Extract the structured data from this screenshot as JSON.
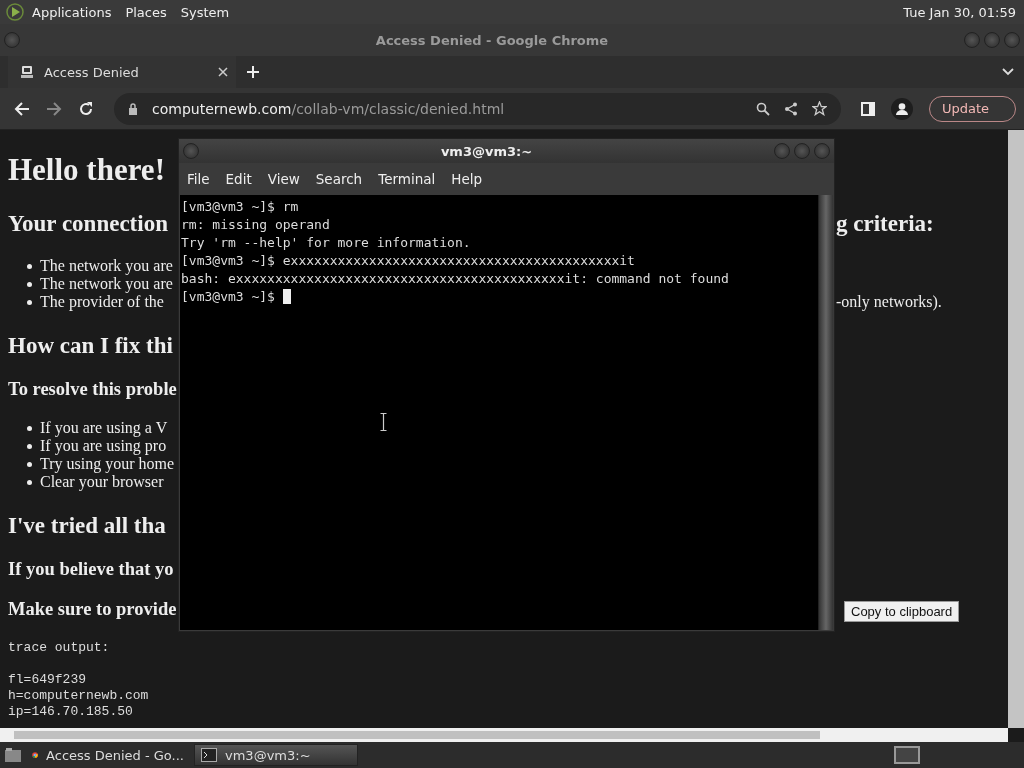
{
  "top_panel": {
    "menus": [
      "Applications",
      "Places",
      "System"
    ],
    "clock": "Tue Jan 30, 01:59"
  },
  "browser": {
    "title": "Access Denied - Google Chrome",
    "tabs": [
      {
        "label": "Access Denied",
        "selected": true
      }
    ],
    "url_domain": "computernewb.com",
    "url_path": "/collab-vm/classic/denied.html",
    "update_label": "Update"
  },
  "page": {
    "left": [
      {
        "kind": "h1",
        "text": "Hello there!"
      },
      {
        "kind": "h2",
        "text": "Your connection"
      },
      {
        "kind": "li",
        "text": "The network you are"
      },
      {
        "kind": "li",
        "text": "The network you are"
      },
      {
        "kind": "li",
        "text": "The provider of the"
      },
      {
        "kind": "h2",
        "text": "How can I fix thi"
      },
      {
        "kind": "h3",
        "text": "To resolve this proble"
      },
      {
        "kind": "li",
        "text": "If you are using a V"
      },
      {
        "kind": "li",
        "text": "If you are using pro"
      },
      {
        "kind": "li",
        "text": "Try using your home"
      },
      {
        "kind": "li",
        "text": "Clear your browser"
      },
      {
        "kind": "h2",
        "text": "I've tried all tha"
      },
      {
        "kind": "h3",
        "text": "If you believe that yo"
      },
      {
        "kind": "h3",
        "text": "Make sure to provide"
      }
    ],
    "trace": {
      "heading": "trace output:",
      "lines": [
        "fl=649f239",
        "h=computernewb.com",
        "ip=146.70.185.50"
      ]
    },
    "right": [
      {
        "kind": "h2",
        "text": "g criteria:"
      },
      {
        "kind": "li",
        "text": "-only networks)."
      }
    ],
    "copy_button": "Copy to clipboard"
  },
  "terminal": {
    "title": "vm3@vm3:~",
    "menus": [
      "File",
      "Edit",
      "View",
      "Search",
      "Terminal",
      "Help"
    ],
    "lines": [
      "[vm3@vm3 ~]$ rm",
      "rm: missing operand",
      "Try 'rm --help' for more information.",
      "[vm3@vm3 ~]$ exxxxxxxxxxxxxxxxxxxxxxxxxxxxxxxxxxxxxxxxxxit",
      "bash: exxxxxxxxxxxxxxxxxxxxxxxxxxxxxxxxxxxxxxxxxxit: command not found",
      "[vm3@vm3 ~]$ "
    ]
  },
  "taskbar": {
    "items": [
      {
        "kind": "browser",
        "label": "Access Denied - Go...",
        "selected": false
      },
      {
        "kind": "terminal",
        "label": "vm3@vm3:~",
        "selected": true
      }
    ]
  }
}
